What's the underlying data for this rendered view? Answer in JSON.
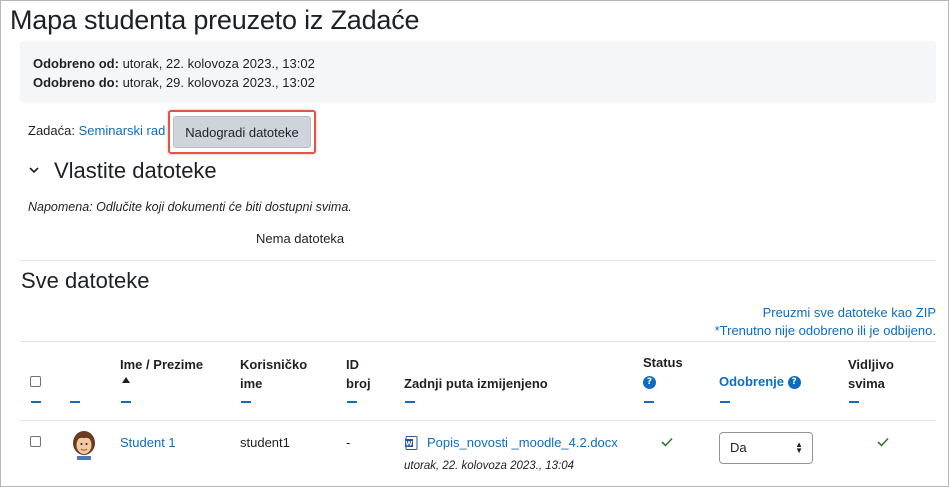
{
  "page": {
    "title": "Mapa studenta preuzeto iz Zadaće"
  },
  "dates": {
    "from_label": "Odobreno od:",
    "from_value": "utorak, 22. kolovoza 2023., 13:02",
    "to_label": "Odobreno do:",
    "to_value": "utorak, 29. kolovoza 2023., 13:02"
  },
  "assignment": {
    "label": "Zadaća:",
    "link": "Seminarski rad",
    "update_button": "Nadogradi datoteke"
  },
  "own_files": {
    "title": "Vlastite datoteke",
    "note": "Napomena: Odlučite koji dokumenti će biti dostupni svima.",
    "empty": "Nema datoteka"
  },
  "all_files": {
    "title": "Sve datoteke",
    "zip_link": "Preuzmi sve datoteke kao ZIP",
    "not_approved_note": "*Trenutno nije odobreno ili je odbijeno."
  },
  "table": {
    "headers": {
      "first_name": "Ime",
      "separator": "/",
      "last_name": "Prezime",
      "username_1": "Korisničko",
      "username_2": "ime",
      "id_1": "ID",
      "id_2": "broj",
      "modified": "Zadnji puta izmijenjeno",
      "status": "Status",
      "approval": "Odobrenje",
      "visible_1": "Vidljivo",
      "visible_2": "svima"
    },
    "rows": [
      {
        "name": "Student 1",
        "username": "student1",
        "id_number": "-",
        "file_name": "Popis_novosti _moodle_4.2.docx",
        "file_date": "utorak, 22. kolovoza 2023., 13:04",
        "approval_value": "Da"
      }
    ]
  },
  "icons": {
    "help": "?",
    "chevron": "chevron-down-icon",
    "file": "word-document-icon",
    "status": "check-icon"
  },
  "colors": {
    "link": "#0f6cbf",
    "highlight": "#e05545",
    "check": "#357a32"
  }
}
